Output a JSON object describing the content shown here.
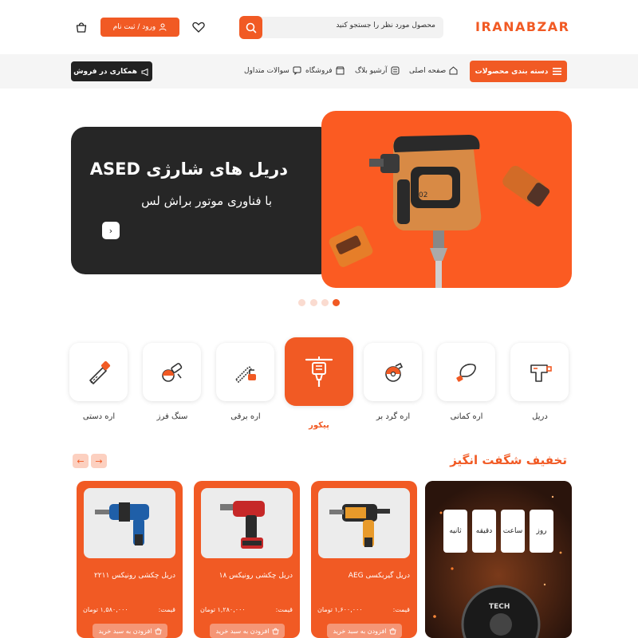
{
  "header": {
    "logo": "IRANABZAR",
    "search_placeholder": "محصول مورد نظر را جستجو کنید",
    "login_label": "ورود / ثبت نام"
  },
  "nav": {
    "categories_label": "دسته بندی محصولات",
    "items": [
      {
        "label": "صفحه اصلی",
        "icon": "home-icon"
      },
      {
        "label": "آرشیو بلاگ",
        "icon": "blog-icon"
      },
      {
        "label": "فروشگاه",
        "icon": "shop-icon"
      },
      {
        "label": "سوالات متداول",
        "icon": "faq-icon"
      }
    ],
    "seller_label": "همکاری در فروش"
  },
  "hero": {
    "title": "دریل های شارژی ASED",
    "subtitle": "با فناوری موتور براش لس",
    "slides": 4,
    "active_slide": 4
  },
  "categories": [
    {
      "label": "دریل",
      "icon": "drill-icon"
    },
    {
      "label": "اره کمانی",
      "icon": "bow-saw-icon"
    },
    {
      "label": "اره گرد بر",
      "icon": "circular-saw-icon"
    },
    {
      "label": "پیکور",
      "icon": "jackhammer-icon",
      "active": true
    },
    {
      "label": "اره برقی",
      "icon": "chainsaw-icon"
    },
    {
      "label": "سنگ فرز",
      "icon": "angle-grinder-icon"
    },
    {
      "label": "اره دستی",
      "icon": "hand-saw-icon"
    }
  ],
  "deals": {
    "title": "تخفیف شگفت انگیز",
    "timer_labels": [
      "روز",
      "ساعت",
      "دقیقه",
      "ثانیه"
    ],
    "products": [
      {
        "name": "دریل گیربکسی AEG",
        "price_label": "قیمت:",
        "price": "۱,۶۰۰,۰۰۰ تومان",
        "cart_label": "افزودن به سبد خرید"
      },
      {
        "name": "دریل چکشی رونیکس ۱۸",
        "price_label": "قیمت:",
        "price": "۱,۲۸۰,۰۰۰ تومان",
        "cart_label": "افزودن به سبد خرید"
      },
      {
        "name": "دریل چکشی رونیکس ۲۲۱۱",
        "price_label": "قیمت:",
        "price": "۱,۵۸۰,۰۰۰ تومان",
        "cart_label": "افزودن به سبد خرید"
      }
    ]
  },
  "colors": {
    "accent": "#f15a24",
    "dark": "#262626"
  }
}
